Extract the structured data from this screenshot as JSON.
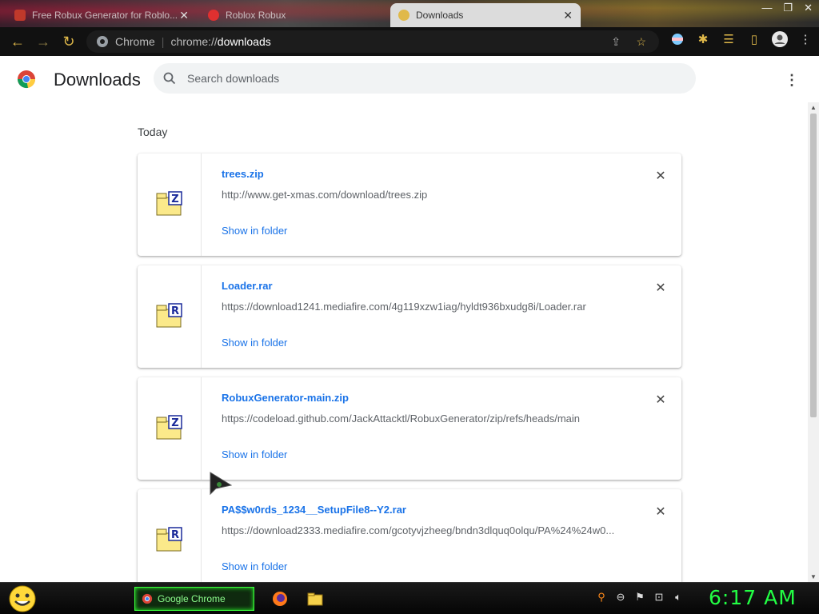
{
  "tabs": [
    {
      "title": "Free Robux Generator for Roblo...",
      "favicon": "page-icon",
      "active": false
    },
    {
      "title": "Roblox Robux",
      "favicon": "roblox-r-icon",
      "active": false
    },
    {
      "title": "Downloads",
      "favicon": "downloads-icon",
      "active": true
    }
  ],
  "omnibox": {
    "scheme_label": "Chrome",
    "url_prefix": "chrome://",
    "url_host": "downloads"
  },
  "page": {
    "title": "Downloads",
    "search_placeholder": "Search downloads",
    "section_label": "Today",
    "downloads": [
      {
        "name": "trees.zip",
        "url": "http://www.get-xmas.com/download/trees.zip",
        "action": "Show in folder",
        "type_letter": "Z"
      },
      {
        "name": "Loader.rar",
        "url": "https://download1241.mediafire.com/4g119xzw1iag/hyldt936bxudg8i/Loader.rar",
        "action": "Show in folder",
        "type_letter": "R"
      },
      {
        "name": "RobuxGenerator-main.zip",
        "url": "https://codeload.github.com/JackAttacktl/RobuxGenerator/zip/refs/heads/main",
        "action": "Show in folder",
        "type_letter": "Z"
      },
      {
        "name": "PA$$w0rds_1234__SetupFile8--Y2.rar",
        "url": "https://download2333.mediafire.com/gcotyvjzheeg/bndn3dlquq0olqu/PA%24%24w0...",
        "action": "Show in folder",
        "type_letter": "R"
      }
    ]
  },
  "taskbar": {
    "active_app": "Google Chrome",
    "clock": "6:17 AM"
  },
  "colors": {
    "link": "#1a73e8",
    "accent_toolbar": "#e0b94a",
    "clock": "#22ff44"
  }
}
